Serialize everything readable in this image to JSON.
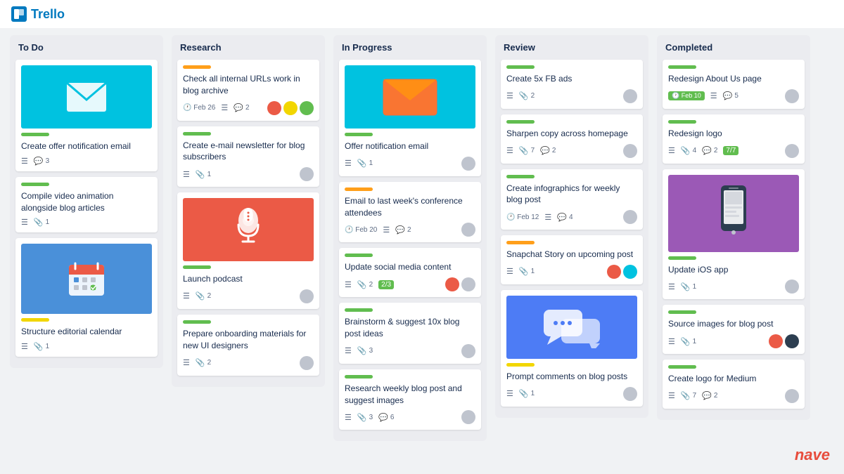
{
  "app": {
    "name": "Trello"
  },
  "columns": [
    {
      "id": "todo",
      "title": "To Do",
      "cards": [
        {
          "id": "todo-1",
          "label": "green",
          "title": "Create offer notification email",
          "meta": {
            "list": true,
            "comments": "3"
          },
          "image": "email",
          "avatars": []
        },
        {
          "id": "todo-2",
          "label": "green",
          "title": "Compile video animation alongside blog articles",
          "meta": {
            "list": true,
            "clips": "1"
          },
          "avatars": []
        },
        {
          "id": "todo-3",
          "label": "yellow",
          "title": "Structure editorial calendar",
          "meta": {
            "list": true,
            "clips": "1"
          },
          "image": "calendar",
          "avatars": []
        }
      ]
    },
    {
      "id": "research",
      "title": "Research",
      "cards": [
        {
          "id": "res-1",
          "label": "orange",
          "title": "Check all internal URLs work in blog archive",
          "meta": {
            "date": "Feb 26",
            "list": true,
            "comments": "2"
          },
          "avatars": [
            "a1",
            "a2",
            "a3"
          ]
        },
        {
          "id": "res-2",
          "label": "green",
          "title": "Create e-mail newsletter for blog subscribers",
          "meta": {
            "list": true,
            "clips": "1"
          },
          "avatars": [
            "a1"
          ]
        },
        {
          "id": "res-3",
          "label": "green",
          "title": "Launch podcast",
          "meta": {
            "list": true,
            "clips": "2"
          },
          "image": "mic",
          "avatars": [
            "a1"
          ]
        },
        {
          "id": "res-4",
          "label": "green",
          "title": "Prepare onboarding materials for new UI designers",
          "meta": {
            "list": true,
            "clips": "2"
          },
          "avatars": [
            "a1"
          ]
        }
      ]
    },
    {
      "id": "inprogress",
      "title": "In Progress",
      "cards": [
        {
          "id": "ip-1",
          "label": "green",
          "title": "Offer notification email",
          "meta": {
            "list": true,
            "clips": "1"
          },
          "image": "envelope",
          "avatars": [
            "a1"
          ]
        },
        {
          "id": "ip-2",
          "label": "orange",
          "title": "Email to last week's conference attendees",
          "meta": {
            "date": "Feb 20",
            "list": true,
            "comments": "2"
          },
          "avatars": [
            "a1"
          ]
        },
        {
          "id": "ip-3",
          "label": "green",
          "title": "Update social media content",
          "meta": {
            "list": true,
            "clips": "2",
            "checklist": "2/3"
          },
          "avatars": [
            "a1",
            "a2"
          ]
        },
        {
          "id": "ip-4",
          "label": "green",
          "title": "Brainstorm & suggest 10x blog post ideas",
          "meta": {
            "list": true,
            "clips": "3"
          },
          "avatars": [
            "a1"
          ]
        },
        {
          "id": "ip-5",
          "label": "green",
          "title": "Research weekly blog post and suggest images",
          "meta": {
            "list": true,
            "clips": "3",
            "comments": "6"
          },
          "avatars": [
            "a1"
          ]
        }
      ]
    },
    {
      "id": "review",
      "title": "Review",
      "cards": [
        {
          "id": "rev-1",
          "label": "green",
          "title": "Create 5x FB ads",
          "meta": {
            "list": true,
            "clips": "2"
          },
          "avatars": [
            "a1"
          ]
        },
        {
          "id": "rev-2",
          "label": "green",
          "title": "Sharpen copy across homepage",
          "meta": {
            "list": true,
            "clips": "7",
            "comments": "2"
          },
          "avatars": [
            "a1"
          ]
        },
        {
          "id": "rev-3",
          "label": "green",
          "title": "Create infographics for weekly blog post",
          "meta": {
            "date": "Feb 12",
            "list": true,
            "comments": "4"
          },
          "avatars": [
            "a1"
          ]
        },
        {
          "id": "rev-4",
          "label": "orange",
          "title": "Snapchat Story on upcoming post",
          "meta": {
            "list": true,
            "clips": "1"
          },
          "avatars": [
            "a1",
            "a2"
          ]
        },
        {
          "id": "rev-5",
          "label": "yellow",
          "title": "Prompt comments on blog posts",
          "meta": {
            "list": true,
            "clips": "1"
          },
          "image": "chat",
          "avatars": [
            "a1"
          ]
        }
      ]
    },
    {
      "id": "completed",
      "title": "Completed",
      "cards": [
        {
          "id": "comp-1",
          "label": "green",
          "title": "Redesign About Us page",
          "meta": {
            "date": "Feb 10",
            "list": true,
            "comments": "5"
          },
          "avatars": [
            "a1"
          ]
        },
        {
          "id": "comp-2",
          "label": "green",
          "title": "Redesign logo",
          "meta": {
            "list": true,
            "clips": "4",
            "comments": "2",
            "checklist": "7/7"
          },
          "avatars": [
            "a1"
          ]
        },
        {
          "id": "comp-3",
          "label": "green",
          "title": "Update iOS app",
          "meta": {
            "list": true,
            "clips": "1"
          },
          "image": "phone",
          "avatars": [
            "a1"
          ]
        },
        {
          "id": "comp-4",
          "label": "green",
          "title": "Source images for blog post",
          "meta": {
            "list": true,
            "clips": "1"
          },
          "avatars": [
            "a1",
            "a2"
          ]
        },
        {
          "id": "comp-5",
          "label": "green",
          "title": "Create logo for Medium",
          "meta": {
            "list": true,
            "clips": "7",
            "comments": "2"
          },
          "avatars": [
            "a1"
          ]
        }
      ]
    }
  ],
  "nave": "nave"
}
